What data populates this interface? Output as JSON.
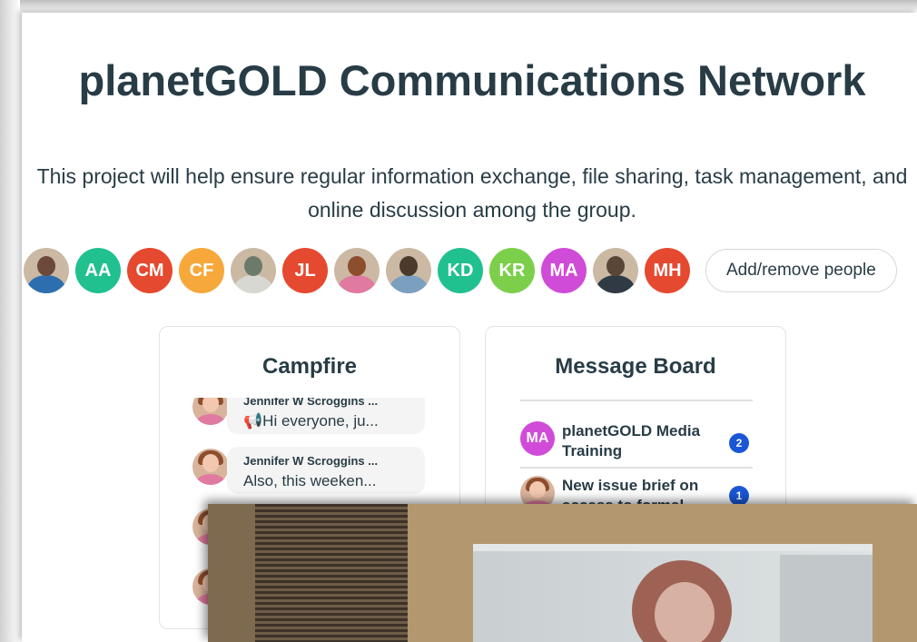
{
  "project": {
    "title": "planetGOLD Communications Network",
    "description": "This project will help ensure regular information exchange, file sharing, task management, and online discussion among the group."
  },
  "people": {
    "avatars": [
      {
        "type": "photo",
        "color": "#6b4a3a",
        "accent": "#2d6fae"
      },
      {
        "type": "initials",
        "initials": "AA",
        "color": "#20c08f"
      },
      {
        "type": "initials",
        "initials": "CM",
        "color": "#e5492f"
      },
      {
        "type": "initials",
        "initials": "CF",
        "color": "#f6a83b"
      },
      {
        "type": "photo",
        "color": "#6c7a6a",
        "accent": "#d8d8d2"
      },
      {
        "type": "initials",
        "initials": "JL",
        "color": "#e5492f"
      },
      {
        "type": "photo",
        "color": "#8c4e2c",
        "accent": "#e07aa0"
      },
      {
        "type": "photo",
        "color": "#4b3a2c",
        "accent": "#7a9fbf"
      },
      {
        "type": "initials",
        "initials": "KD",
        "color": "#20c08f"
      },
      {
        "type": "initials",
        "initials": "KR",
        "color": "#7ccf4b"
      },
      {
        "type": "initials",
        "initials": "MA",
        "color": "#d04bd8"
      },
      {
        "type": "photo",
        "color": "#5a4636",
        "accent": "#2f3a44"
      },
      {
        "type": "initials",
        "initials": "MH",
        "color": "#e5492f"
      }
    ],
    "add_remove_label": "Add/remove people"
  },
  "campfire": {
    "title": "Campfire",
    "messages": [
      {
        "name": "Jennifer W Scroggins ...",
        "text": "📢Hi everyone, ju..."
      },
      {
        "name": "Jennifer W Scroggins ...",
        "text": "Also, this weeken..."
      }
    ]
  },
  "message_board": {
    "title": "Message Board",
    "items": [
      {
        "avatar": "MA",
        "title": "planetGOLD Media Training",
        "badge": "2"
      },
      {
        "avatar": "",
        "title": "New issue brief on access to formal",
        "badge": "1"
      }
    ]
  }
}
